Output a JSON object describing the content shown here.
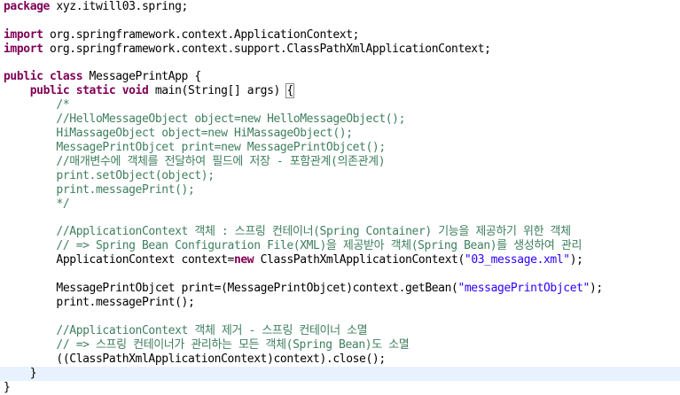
{
  "editor": {
    "colors": {
      "keyword": "#7f0055",
      "comment": "#3f7f5f",
      "string": "#2a00ff",
      "current_line": "#e8f2fe"
    },
    "code": {
      "l1_kw": "package",
      "l1_rest": " xyz.itwill03.spring;",
      "l3_kw": "import",
      "l3_rest": " org.springframework.context.ApplicationContext;",
      "l4_kw": "import",
      "l4_rest": " org.springframework.context.support.ClassPathXmlApplicationContext;",
      "l6_kw": "public class",
      "l6_rest": " MessagePrintApp {",
      "l7_kw": "public static void",
      "l7_rest": " main(String[] args) ",
      "l7_brace": "{",
      "l8": "/*",
      "l9": "//HelloMessageObject object=new HelloMessageObject();",
      "l10": "HiMassageObject object=new HiMassageObject();",
      "l11": "MessagePrintObjcet print=new MessagePrintObjcet();",
      "l12": "//매개변수에 객체를 전달하여 필드에 저장 - 포함관계(의존관계)",
      "l13": "print.setObject(object);",
      "l14": "print.messagePrint();",
      "l15": "*/",
      "l17": "//ApplicationContext 객체 : 스프링 컨테이너(Spring Container) 기능을 제공하기 위한 객체",
      "l18": "// => Spring Bean Configuration File(XML)을 제공받아 객체(Spring Bean)를 생성하여 관리",
      "l19_a": "ApplicationContext context=",
      "l19_kw": "new",
      "l19_b": " ClassPathXmlApplicationContext(",
      "l19_str": "\"03_message.xml\"",
      "l19_c": ");",
      "l21_a": "MessagePrintObjcet print=(MessagePrintObjcet)context.getBean(",
      "l21_str": "\"messagePrintObjcet\"",
      "l21_b": ");",
      "l22": "print.messagePrint();",
      "l24": "//ApplicationContext 객체 제거 - 스프링 컨테이너 소멸",
      "l25": "// => 스프링 컨테이너가 관리하는 모든 객체(Spring Bean)도 소멸",
      "l26": "((ClassPathXmlApplicationContext)context).close();",
      "l27": "}",
      "l28": "}"
    }
  }
}
